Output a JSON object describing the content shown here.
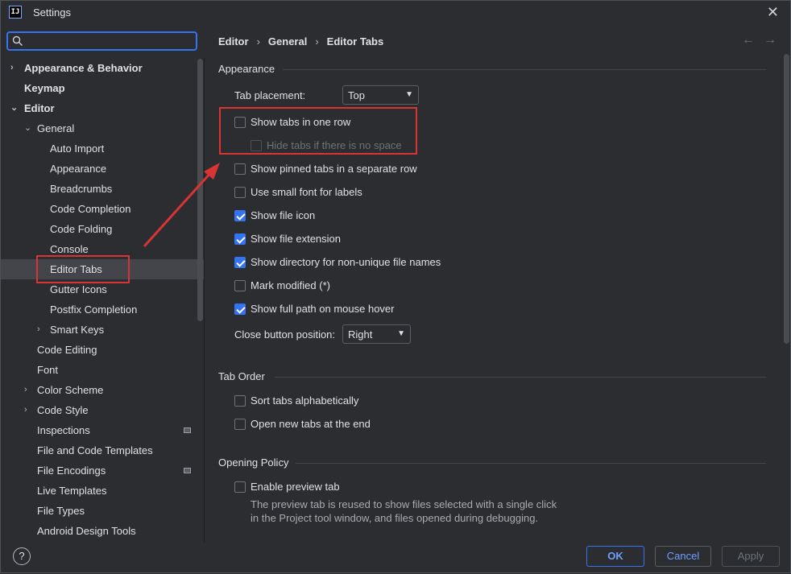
{
  "window": {
    "title": "Settings",
    "app_icon_text": "IJ"
  },
  "search": {
    "placeholder": ""
  },
  "tree": {
    "items": [
      {
        "label": "Appearance & Behavior",
        "chevron": "›"
      },
      {
        "label": "Keymap",
        "chevron": ""
      },
      {
        "label": "Editor",
        "chevron": "⌄"
      },
      {
        "label": "General",
        "chevron": "⌄"
      },
      {
        "label": "Auto Import",
        "chevron": ""
      },
      {
        "label": "Appearance",
        "chevron": ""
      },
      {
        "label": "Breadcrumbs",
        "chevron": ""
      },
      {
        "label": "Code Completion",
        "chevron": ""
      },
      {
        "label": "Code Folding",
        "chevron": ""
      },
      {
        "label": "Console",
        "chevron": ""
      },
      {
        "label": "Editor Tabs",
        "chevron": ""
      },
      {
        "label": "Gutter Icons",
        "chevron": ""
      },
      {
        "label": "Postfix Completion",
        "chevron": ""
      },
      {
        "label": "Smart Keys",
        "chevron": "›"
      },
      {
        "label": "Code Editing",
        "chevron": ""
      },
      {
        "label": "Font",
        "chevron": ""
      },
      {
        "label": "Color Scheme",
        "chevron": "›"
      },
      {
        "label": "Code Style",
        "chevron": "›"
      },
      {
        "label": "Inspections",
        "chevron": ""
      },
      {
        "label": "File and Code Templates",
        "chevron": ""
      },
      {
        "label": "File Encodings",
        "chevron": ""
      },
      {
        "label": "Live Templates",
        "chevron": ""
      },
      {
        "label": "File Types",
        "chevron": ""
      },
      {
        "label": "Android Design Tools",
        "chevron": ""
      }
    ]
  },
  "breadcrumb": {
    "items": [
      "Editor",
      "General",
      "Editor Tabs"
    ],
    "separator": "›"
  },
  "nav": {
    "back": "←",
    "forward": "→"
  },
  "appearance": {
    "section_title": "Appearance",
    "tab_placement_label": "Tab placement:",
    "tab_placement_value": "Top",
    "checks": [
      {
        "label": "Show tabs in one row",
        "checked": false,
        "disabled": false
      },
      {
        "label": "Hide tabs if there is no space",
        "checked": false,
        "disabled": true
      },
      {
        "label": "Show pinned tabs in a separate row",
        "checked": false,
        "disabled": false
      },
      {
        "label": "Use small font for labels",
        "checked": false,
        "disabled": false
      },
      {
        "label": "Show file icon",
        "checked": true,
        "disabled": false
      },
      {
        "label": "Show file extension",
        "checked": true,
        "disabled": false
      },
      {
        "label": "Show directory for non-unique file names",
        "checked": true,
        "disabled": false
      },
      {
        "label": "Mark modified (*)",
        "checked": false,
        "disabled": false
      },
      {
        "label": "Show full path on mouse hover",
        "checked": true,
        "disabled": false
      }
    ],
    "close_button_label": "Close button position:",
    "close_button_value": "Right"
  },
  "tab_order": {
    "section_title": "Tab Order",
    "checks": [
      {
        "label": "Sort tabs alphabetically",
        "checked": false
      },
      {
        "label": "Open new tabs at the end",
        "checked": false
      }
    ]
  },
  "opening_policy": {
    "section_title": "Opening Policy",
    "preview_label": "Enable preview tab",
    "preview_checked": false,
    "preview_help_line1": "The preview tab is reused to show files selected with a single click",
    "preview_help_line2": "in the Project tool window, and files opened during debugging."
  },
  "footer": {
    "help": "?",
    "ok": "OK",
    "cancel": "Cancel",
    "apply": "Apply"
  },
  "colors": {
    "accent": "#3574f0",
    "annotation": "#d93434",
    "background": "#2b2d30",
    "selection": "#43454a"
  }
}
